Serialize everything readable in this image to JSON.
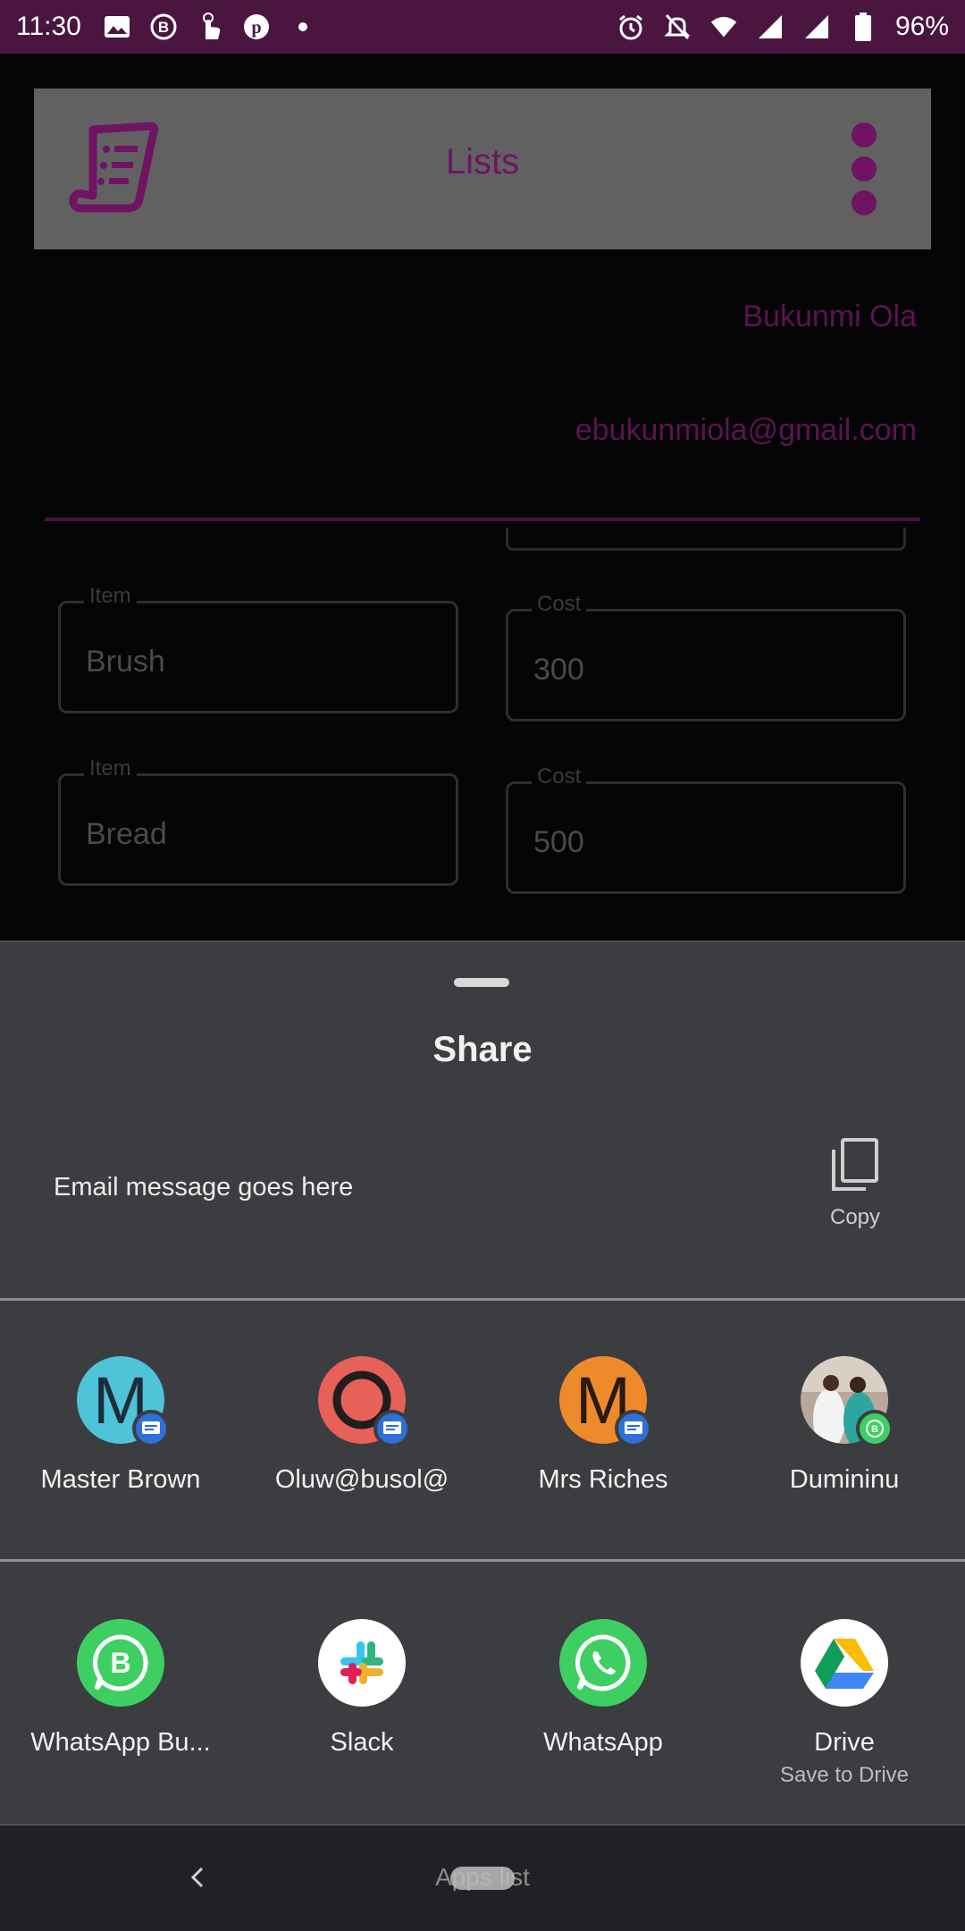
{
  "status_bar": {
    "time": "11:30",
    "battery": "96%",
    "icons_left": [
      "image-icon",
      "b-icon",
      "touch-icon",
      "pinterest-icon",
      "dot-icon"
    ],
    "icons_right": [
      "alarm-icon",
      "mute-icon",
      "wifi-icon",
      "signal-icon",
      "signal-icon",
      "battery-icon"
    ]
  },
  "app": {
    "title": "Lists",
    "user_name": "Bukunmi Ola",
    "user_email": "ebukunmiola@gmail.com",
    "items": [
      {
        "item_label": "Item",
        "item_value": "Brush",
        "cost_label": "Cost",
        "cost_value": "300"
      },
      {
        "item_label": "Item",
        "item_value": "Bread",
        "cost_label": "Cost",
        "cost_value": "500"
      }
    ]
  },
  "share_sheet": {
    "title": "Share",
    "message": "Email message goes here",
    "copy_label": "Copy",
    "direct_targets": [
      {
        "label": "Master Brown",
        "initial": "M",
        "color": "#4fc3d8",
        "badge": "message-icon"
      },
      {
        "label": "Oluw@busol@",
        "initial": "",
        "color": "#e8605a",
        "badge": "message-icon"
      },
      {
        "label": "Mrs Riches",
        "initial": "M",
        "color": "#ef8a2c",
        "badge": "message-icon"
      },
      {
        "label": "Dumininu",
        "initial": "",
        "color": "#9b8f86",
        "badge": "whatsapp-business-icon"
      }
    ],
    "apps": [
      {
        "label": "WhatsApp Bu...",
        "sub": "",
        "color": "#3ecf62"
      },
      {
        "label": "Slack",
        "sub": "",
        "color": "#ffffff"
      },
      {
        "label": "WhatsApp",
        "sub": "",
        "color": "#3ecf62"
      },
      {
        "label": "Drive",
        "sub": "Save to Drive",
        "color": "#ffffff"
      }
    ]
  },
  "nav_bar": {
    "home_text": "Apps list"
  }
}
